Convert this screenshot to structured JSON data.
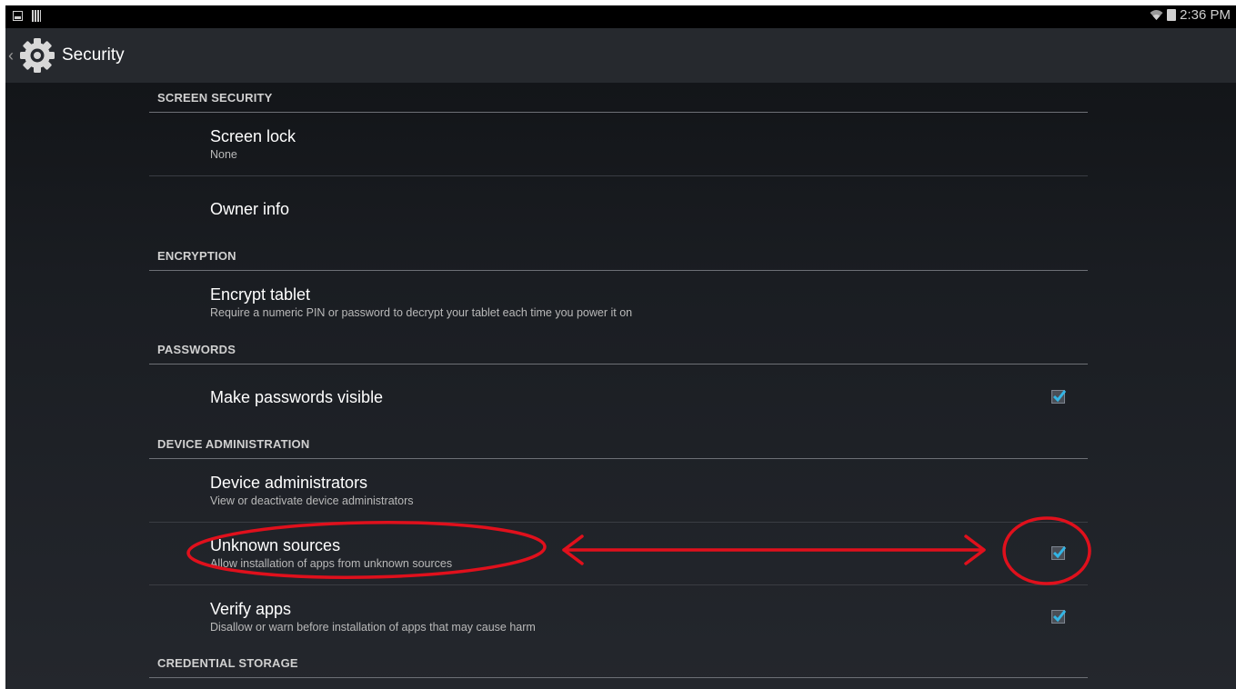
{
  "status_bar": {
    "time": "2:36 PM",
    "icons": [
      "image-icon",
      "barcode-icon",
      "wifi-icon",
      "battery-icon"
    ]
  },
  "action_bar": {
    "title": "Security",
    "icon": "gear-icon"
  },
  "sections": {
    "screen_security": {
      "header": "SCREEN SECURITY",
      "items": {
        "screen_lock": {
          "title": "Screen lock",
          "summary": "None"
        },
        "owner_info": {
          "title": "Owner info"
        }
      }
    },
    "encryption": {
      "header": "ENCRYPTION",
      "items": {
        "encrypt_tablet": {
          "title": "Encrypt tablet",
          "summary": "Require a numeric PIN or password to decrypt your tablet each time you power it on"
        }
      }
    },
    "passwords": {
      "header": "PASSWORDS",
      "items": {
        "make_passwords_visible": {
          "title": "Make passwords visible",
          "checked": true
        }
      }
    },
    "device_administration": {
      "header": "DEVICE ADMINISTRATION",
      "items": {
        "device_administrators": {
          "title": "Device administrators",
          "summary": "View or deactivate device administrators"
        },
        "unknown_sources": {
          "title": "Unknown sources",
          "summary": "Allow installation of apps from unknown sources",
          "checked": true
        },
        "verify_apps": {
          "title": "Verify apps",
          "summary": "Disallow or warn before installation of apps that may cause harm",
          "checked": true
        }
      }
    },
    "credential_storage": {
      "header": "CREDENTIAL STORAGE"
    }
  },
  "colors": {
    "accent": "#33b5e5",
    "annotation": "#e0101c",
    "action_bar": "#26292e",
    "divider": "#6d7076"
  }
}
